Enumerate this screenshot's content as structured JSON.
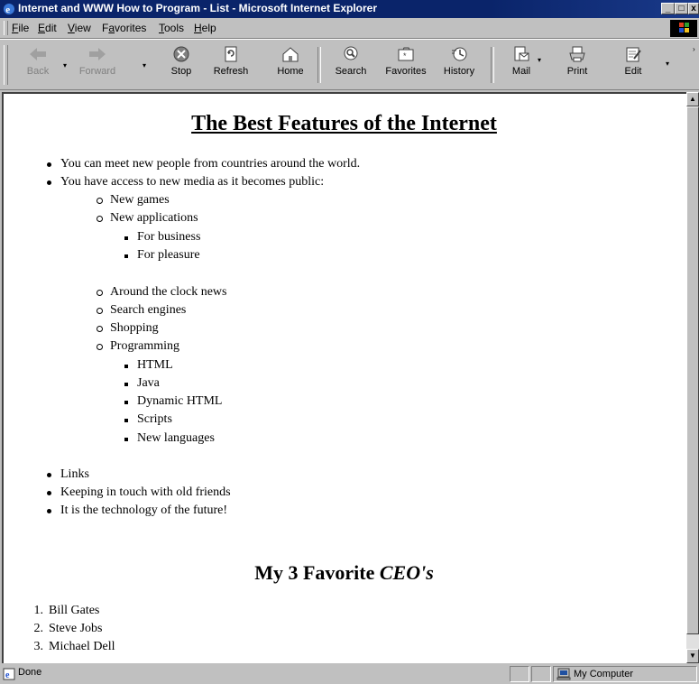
{
  "window": {
    "title": "Internet and WWW How to Program - List - Microsoft Internet Explorer",
    "controls": [
      "minimize",
      "maximize",
      "close"
    ]
  },
  "menu": [
    "File",
    "Edit",
    "View",
    "Favorites",
    "Tools",
    "Help"
  ],
  "menu_accel": [
    "F",
    "E",
    "V",
    "a",
    "T",
    "H"
  ],
  "toolbar": {
    "back": "Back",
    "forward": "Forward",
    "stop": "Stop",
    "refresh": "Refresh",
    "home": "Home",
    "search": "Search",
    "favorites": "Favorites",
    "history": "History",
    "mail": "Mail",
    "print": "Print",
    "edit": "Edit"
  },
  "page": {
    "heading": "The Best Features of the Internet",
    "list": {
      "item1": "You can meet new people from countries around the world.",
      "item2": "You have access to new media as it becomes public:",
      "sub": {
        "games": "New games",
        "apps": "New applications",
        "business": "For business",
        "pleasure": "For pleasure",
        "news": "Around the clock news",
        "search": "Search engines",
        "shopping": "Shopping",
        "programming": "Programming",
        "html": "HTML",
        "java": "Java",
        "dhtml": "Dynamic HTML",
        "scripts": "Scripts",
        "languages": "New languages"
      },
      "item3": "Links",
      "item4": "Keeping in touch with old friends",
      "item5": "It is the technology of the future!"
    },
    "heading2_prefix": "My 3 Favorite ",
    "heading2_em": "CEO's",
    "ceos": [
      "Bill Gates",
      "Steve Jobs",
      "Michael Dell"
    ],
    "ceo_numbers": [
      "1.",
      "2.",
      "3."
    ]
  },
  "status": {
    "text": "Done",
    "zone": "My Computer"
  }
}
